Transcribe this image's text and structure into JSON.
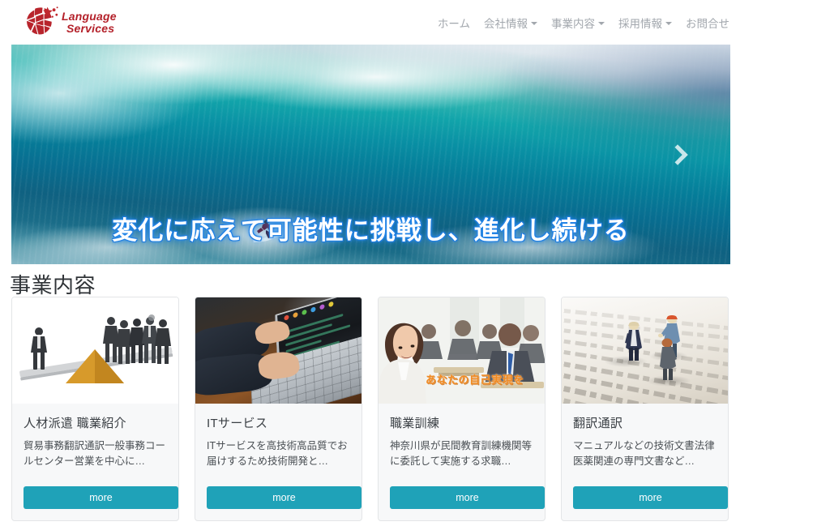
{
  "site": {
    "brand": {
      "line1": "Language",
      "line2": "Services",
      "icon": "globe-star-logo",
      "color": "#b4212a"
    },
    "nav": [
      {
        "label": "ホーム",
        "has_dropdown": false,
        "name": "nav-home"
      },
      {
        "label": "会社情報",
        "has_dropdown": true,
        "name": "nav-company"
      },
      {
        "label": "事業内容",
        "has_dropdown": true,
        "name": "nav-business"
      },
      {
        "label": "採用情報",
        "has_dropdown": true,
        "name": "nav-recruit"
      },
      {
        "label": "お問合せ",
        "has_dropdown": false,
        "name": "nav-contact"
      }
    ]
  },
  "hero": {
    "caption": "変化に応えて可能性に挑戦し、進化し続ける",
    "image_alt": "surfer-riding-large-blue-wave",
    "next_arrow_icon": "chevron-right-icon"
  },
  "section": {
    "title": "事業内容"
  },
  "cards": [
    {
      "title": "人材派遣 職業紹介",
      "text": "貿易事務翻訳通訳一般事務コールセンター営業を中心に…",
      "button": "more",
      "image_alt": "seesaw-balance-one-person-vs-group"
    },
    {
      "title": "ITサービス",
      "text": "ITサービスを高技術高品質でお届けするため技術開発と…",
      "button": "more",
      "image_alt": "hands-typing-on-laptop-keyboard"
    },
    {
      "title": "職業訓練",
      "text": "神奈川県が民間教育訓練機関等に委託して実施する求職…",
      "button": "more",
      "image_alt": "classroom-of-business-people",
      "image_caption": "あなたの自己実現を"
    },
    {
      "title": "翻訳通訳",
      "text": "マニュアルなどの技術文書法律医薬関連の専門文書など…",
      "button": "more",
      "image_alt": "miniature-figurines-standing-on-open-book"
    }
  ],
  "colors": {
    "accent_button": "#1fa2b8",
    "brand_red": "#b4212a",
    "card_bg": "#f7f8f9",
    "card_border": "#e3e5e7",
    "nav_text": "#a2a7ad"
  }
}
